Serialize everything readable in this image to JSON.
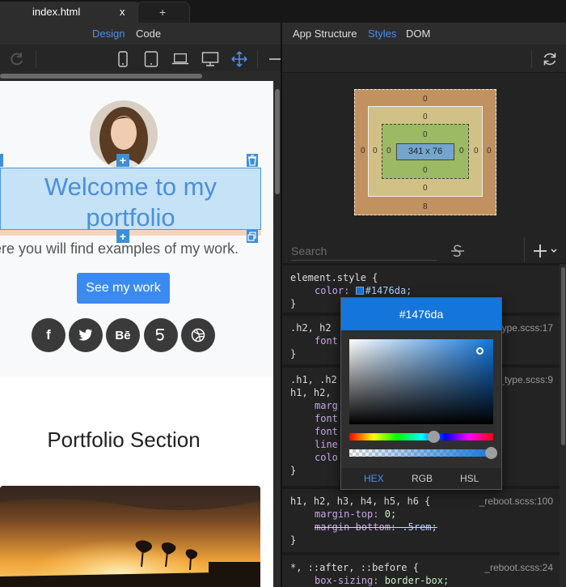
{
  "tabs": [
    {
      "label": "index.html",
      "close": "x"
    },
    {
      "label": "+"
    }
  ],
  "left_toolbar": {
    "design": "Design",
    "code": "Code"
  },
  "page": {
    "headline": "Welcome to my portfolio",
    "subtitle": "ere you will find examples of my work.",
    "cta": "See my work",
    "handle_plus": "+",
    "social": [
      "f",
      "Bē"
    ],
    "portfolio_title": "Portfolio Section"
  },
  "right_tabs": {
    "app_structure": "App Structure",
    "styles": "Styles",
    "dom": "DOM"
  },
  "box_model": {
    "margin": {
      "top": "0",
      "right": "0",
      "bottom": "8",
      "left": "0"
    },
    "border": {
      "top": "0",
      "right": "0",
      "bottom": "0",
      "left": "0"
    },
    "padding": {
      "top": "0",
      "right": "0",
      "bottom": "0",
      "left": "0"
    },
    "content": "341 x 76"
  },
  "search": {
    "placeholder": "Search"
  },
  "rules": [
    {
      "selector": "element.style {",
      "lines": [
        {
          "prop": "color:",
          "value": "#1476da;"
        }
      ],
      "close": "}"
    },
    {
      "selector": ".h2, h2",
      "source": "_type.scss:17",
      "lines": [
        {
          "prop": "font",
          "value": ""
        }
      ],
      "close": "}"
    },
    {
      "selector": ".h1, .h2",
      "selector2": "h1, h2,",
      "source": "_type.scss:9",
      "props": [
        "marg",
        "font",
        "font",
        "line",
        "colo"
      ],
      "close": "}"
    },
    {
      "selector": "h1, h2, h3, h4, h5, h6 {",
      "source": "_reboot.scss:100",
      "lines": [
        {
          "prop": "margin-top:",
          "value": "0;"
        },
        {
          "prop": "margin-bottom:",
          "value": ".5rem;"
        }
      ],
      "close": "}"
    },
    {
      "selector": "*, ::after, ::before {",
      "source": "_reboot.scss:24",
      "lines": [
        {
          "prop": "box-sizing:",
          "value": "border-box;"
        }
      ]
    }
  ],
  "picker": {
    "hex": "#1476da",
    "formats": [
      "HEX",
      "RGB",
      "HSL"
    ],
    "active_format": "HEX"
  },
  "colors": {
    "accent": "#1476da",
    "link": "#4a90e2",
    "cta": "#3b8af0"
  }
}
